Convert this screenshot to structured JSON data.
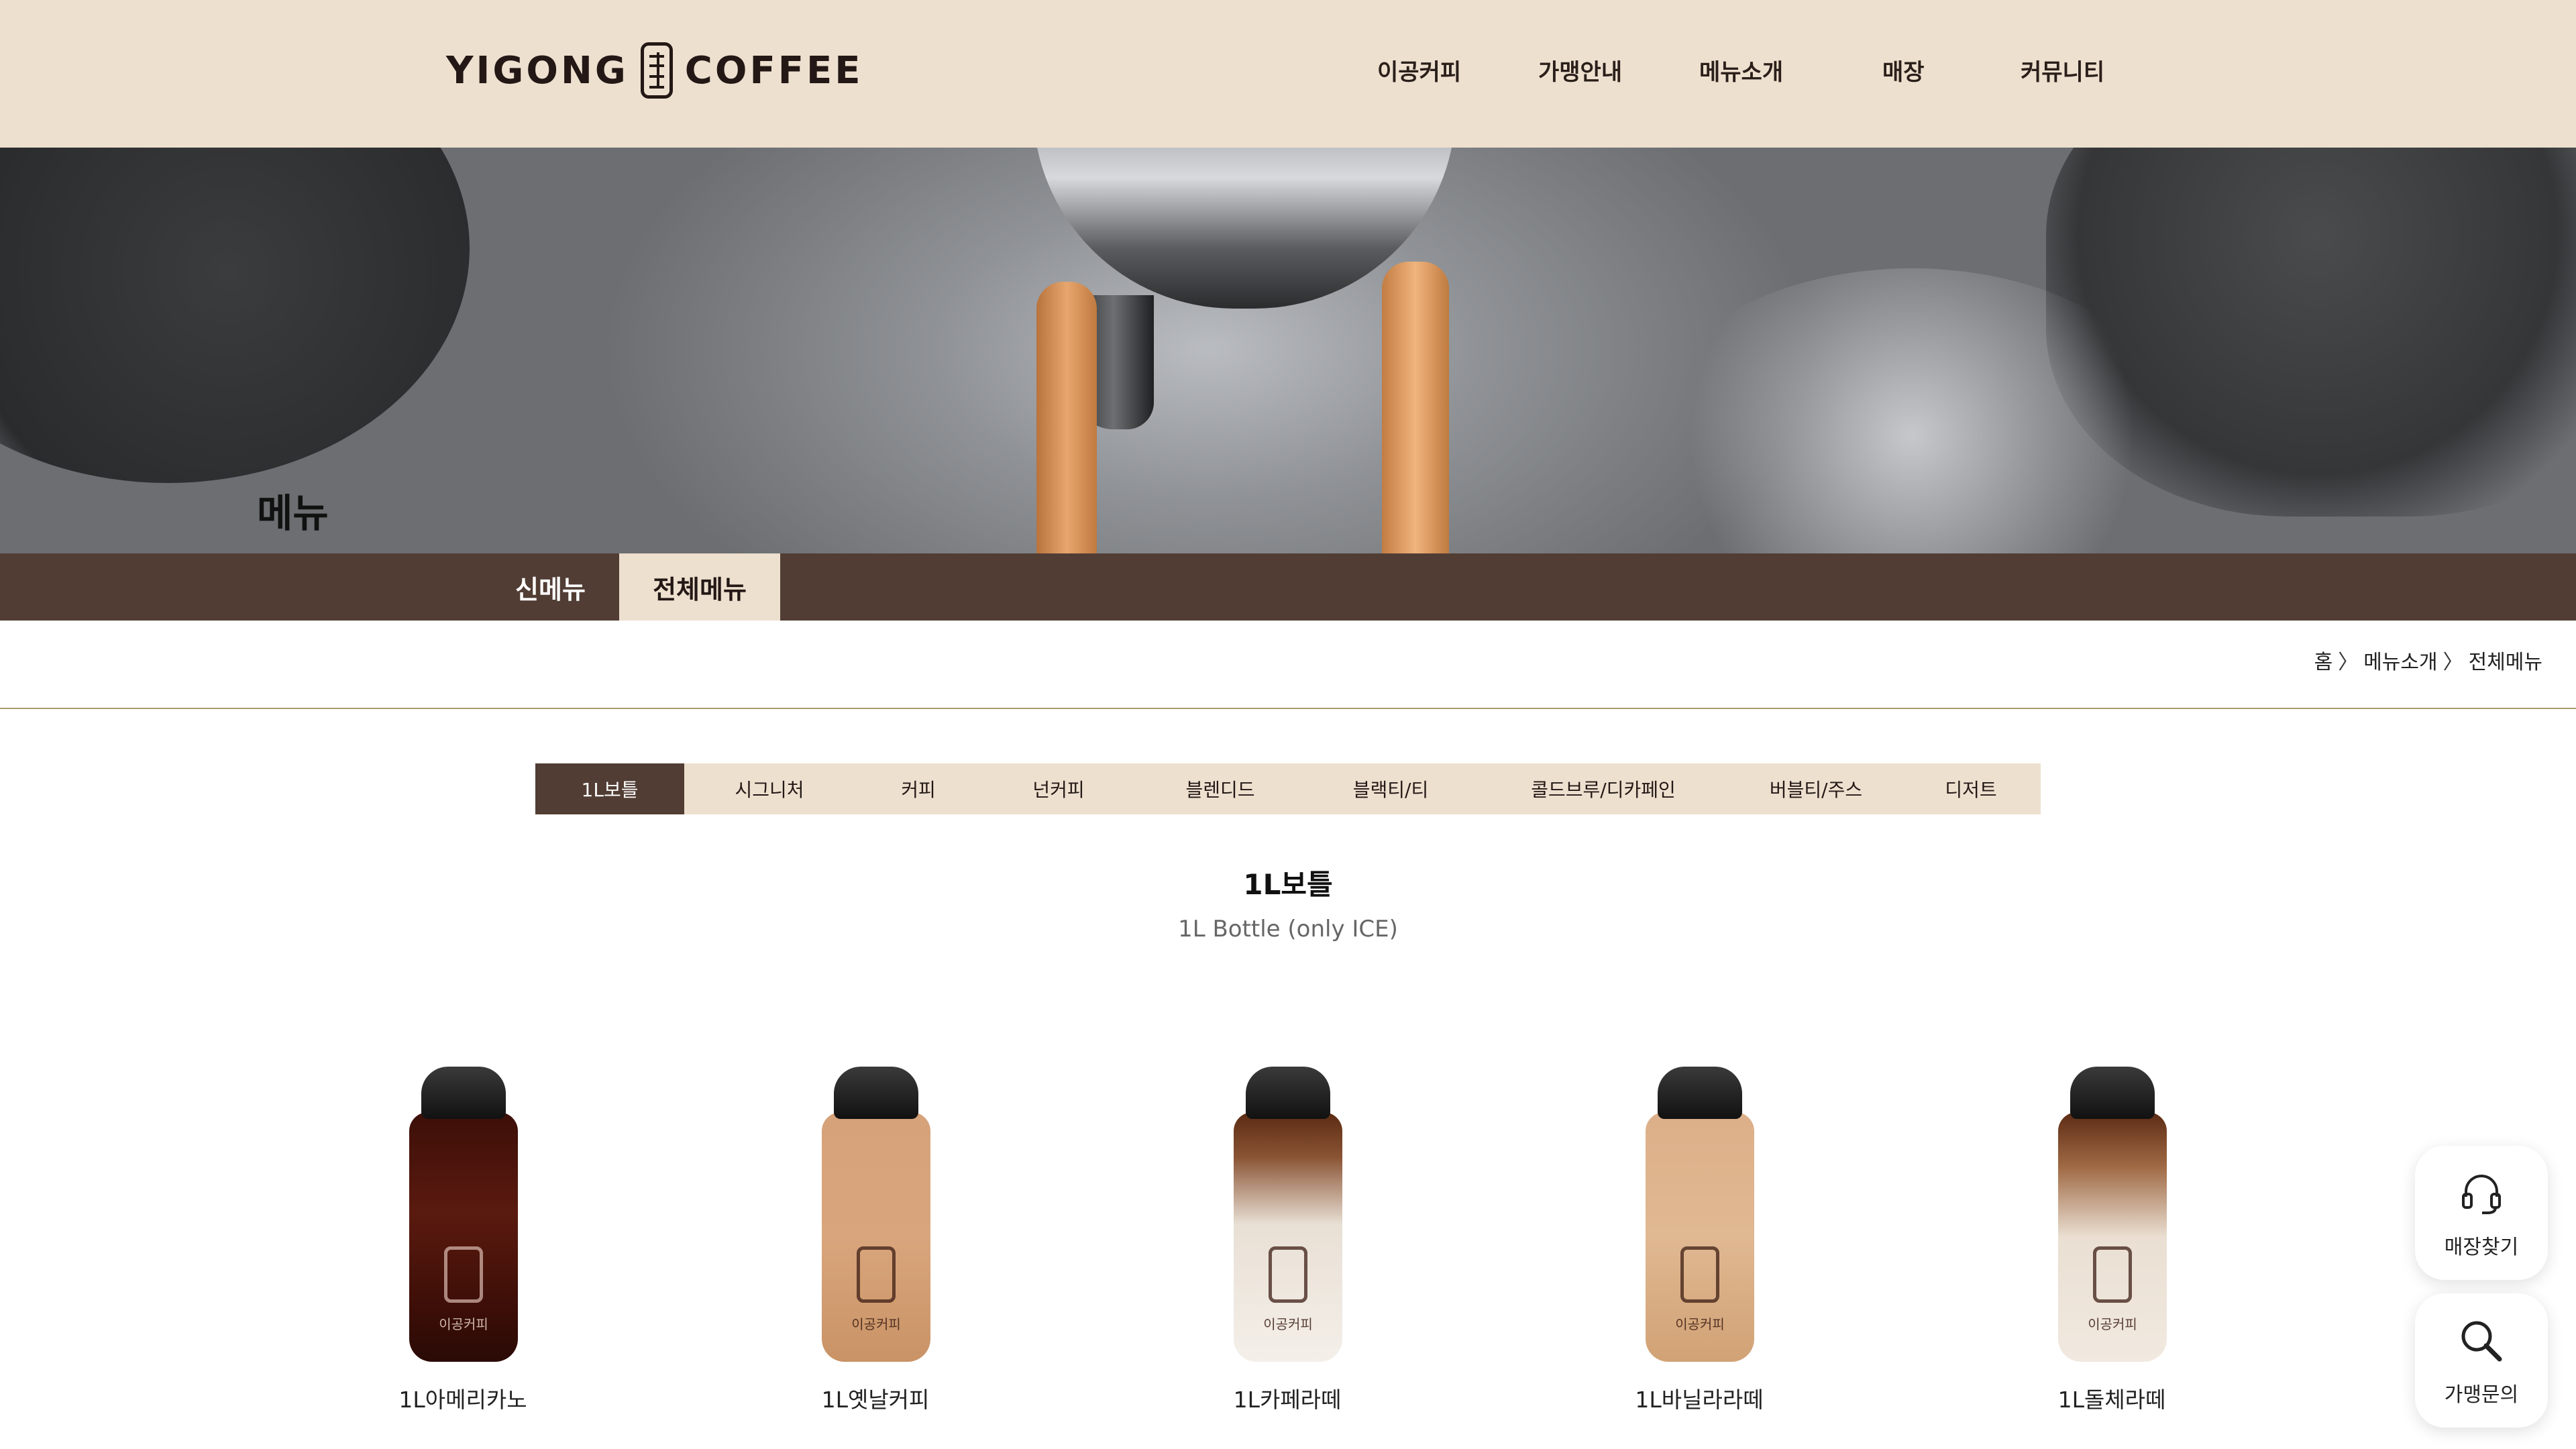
{
  "header": {
    "logo_left": "YIGONG",
    "logo_right": "COFFEE",
    "nav": [
      "이공커피",
      "가맹안내",
      "메뉴소개",
      "매장",
      "커뮤니티"
    ]
  },
  "hero": {
    "title": "메뉴"
  },
  "subnav": {
    "tabs": [
      "신메뉴",
      "전체메뉴"
    ],
    "active": "전체메뉴"
  },
  "breadcrumb": [
    "홈",
    "메뉴소개",
    "전체메뉴"
  ],
  "categories": {
    "items": [
      "1L보틀",
      "시그니처",
      "커피",
      "넌커피",
      "블렌디드",
      "블랙티/티",
      "콜드브루/디카페인",
      "버블티/주스",
      "디저트"
    ],
    "active": "1L보틀"
  },
  "section": {
    "title": "1L보틀",
    "subtitle": "1L Bottle (only ICE)"
  },
  "products": [
    {
      "name": "1L아메리카노",
      "bottle_brand": "이공커피"
    },
    {
      "name": "1L옛날커피",
      "bottle_brand": "이공커피"
    },
    {
      "name": "1L카페라떼",
      "bottle_brand": "이공커피"
    },
    {
      "name": "1L바닐라라떼",
      "bottle_brand": "이공커피"
    },
    {
      "name": "1L돌체라떼",
      "bottle_brand": "이공커피"
    }
  ],
  "floating": {
    "store_finder": "매장찾기",
    "franchise_inquiry": "가맹문의"
  },
  "colors": {
    "header_bg": "#ede0cf",
    "brown": "#513d34",
    "divider": "#a99a6a"
  }
}
